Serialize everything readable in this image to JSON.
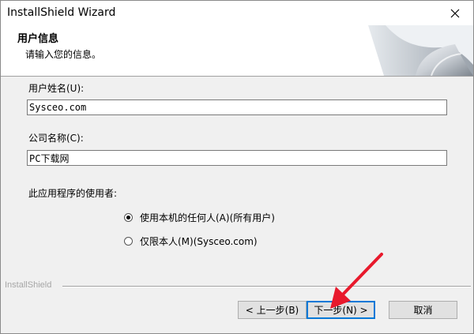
{
  "window": {
    "title": "InstallShield Wizard",
    "close_symbol": "✕"
  },
  "header": {
    "title": "用户信息",
    "subtitle": "请输入您的信息。"
  },
  "form": {
    "username_label": "用户姓名(U):",
    "username_value": "Sysceo.com",
    "company_label": "公司名称(C):",
    "company_value": "PC下载网",
    "users_label": "此应用程序的使用者:",
    "options": [
      {
        "label": "使用本机的任何人(A)(所有用户)",
        "checked": true
      },
      {
        "label": "仅限本人(M)(Sysceo.com)",
        "checked": false
      }
    ]
  },
  "footer": {
    "brand": "InstallShield",
    "back_label": "< 上一步(B)",
    "next_label": "下一步(N) >",
    "cancel_label": "取消"
  },
  "colors": {
    "annotation_arrow": "#e8192c",
    "focus": "#0078d7"
  }
}
